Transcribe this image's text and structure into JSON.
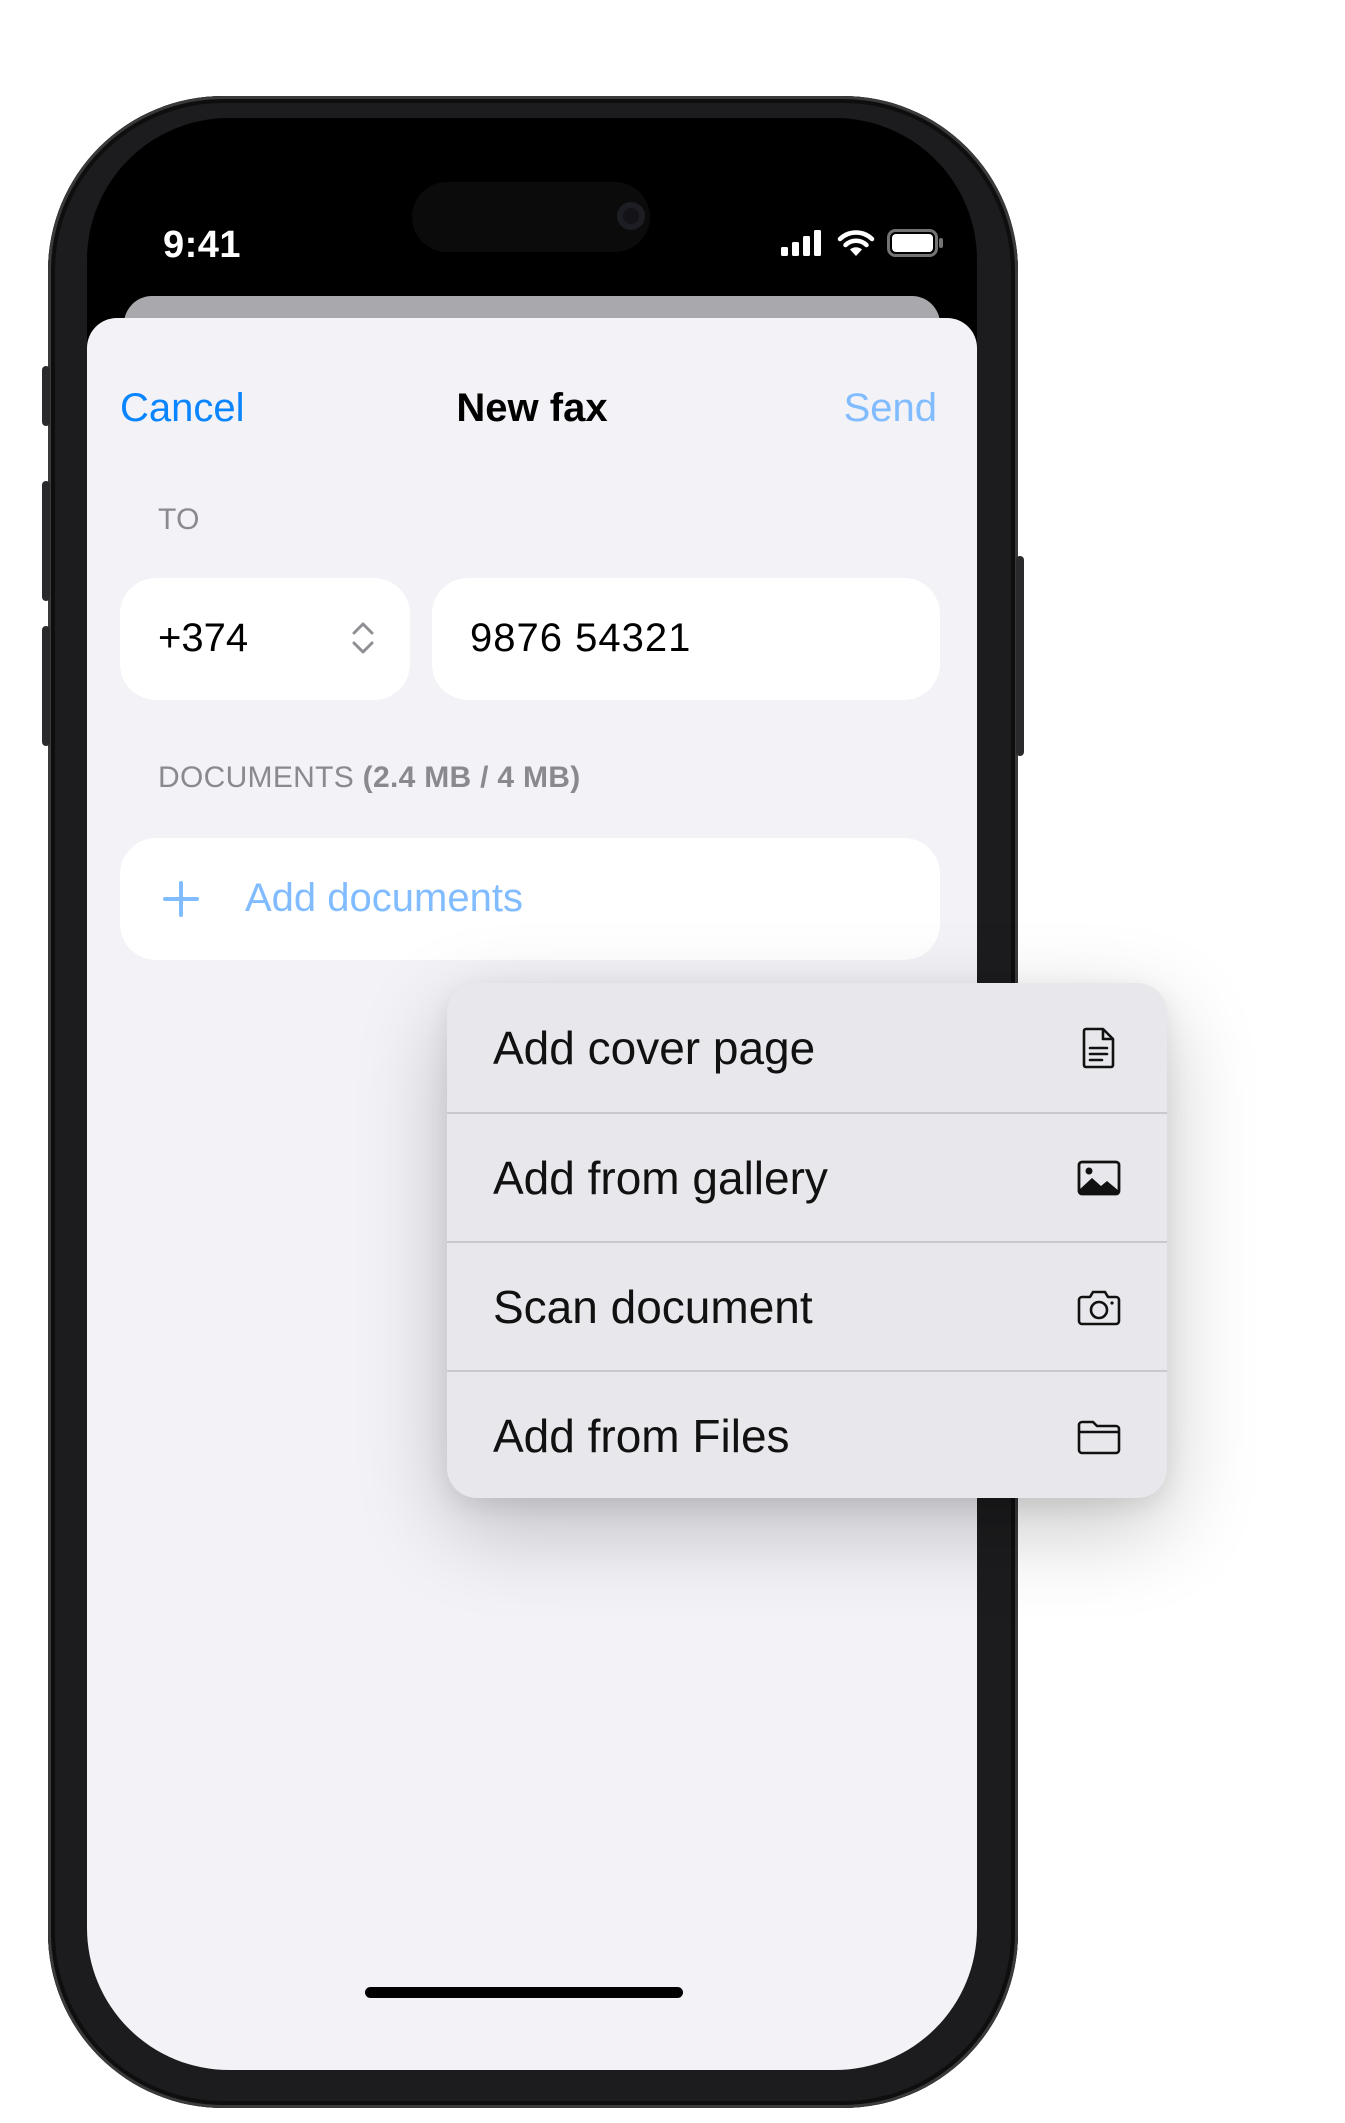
{
  "status_bar": {
    "time": "9:41",
    "icons": [
      "cellular-signal-icon",
      "wifi-icon",
      "battery-icon"
    ]
  },
  "nav": {
    "cancel": "Cancel",
    "title": "New fax",
    "send": "Send"
  },
  "to_section": {
    "label": "TO",
    "country_code": "+374",
    "phone_number": "9876 54321"
  },
  "documents_section": {
    "label": "DOCUMENTS",
    "size_info": "(2.4 MB / 4 MB)",
    "add_label": "Add documents"
  },
  "menu": {
    "items": [
      {
        "label": "Add cover page",
        "icon": "document-icon"
      },
      {
        "label": "Add from gallery",
        "icon": "photo-icon"
      },
      {
        "label": "Scan document",
        "icon": "camera-icon"
      },
      {
        "label": "Add from Files",
        "icon": "folder-icon"
      }
    ]
  },
  "colors": {
    "accent": "#0a84ff",
    "accent_disabled": "#80bcff",
    "sheet_background": "#f2f2f7",
    "menu_background": "#e8e8ec"
  }
}
